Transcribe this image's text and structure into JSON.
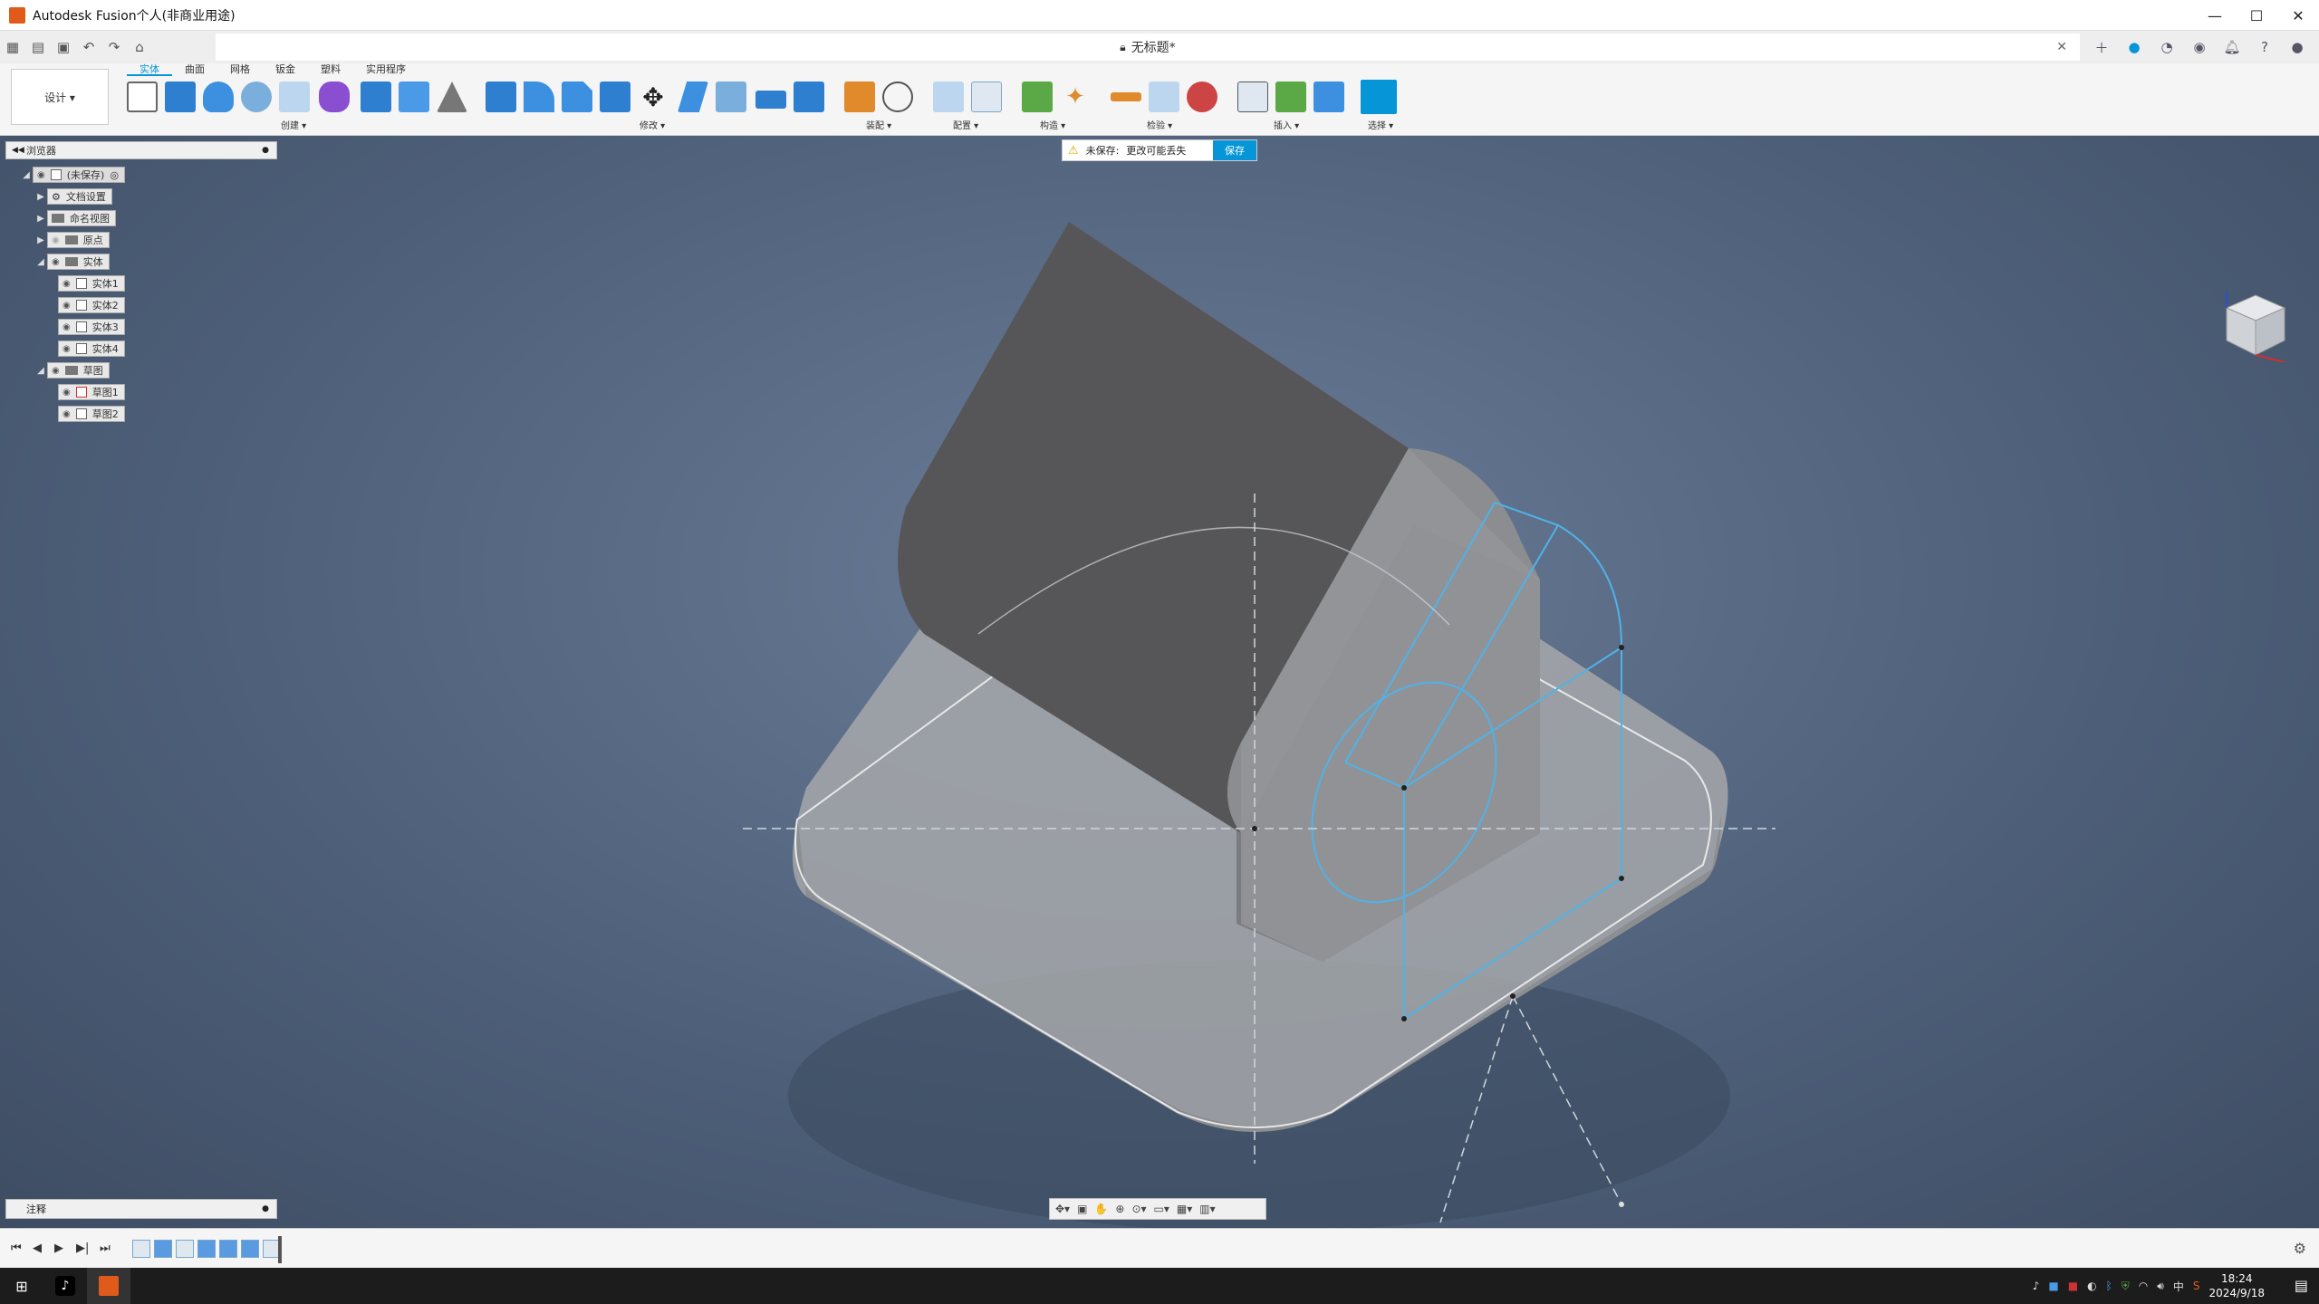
{
  "app": {
    "title": "Autodesk Fusion个人(非商业用途)",
    "document_title": "无标题*"
  },
  "ribbon": {
    "workspace": "设计 ▾",
    "tabs": [
      "实体",
      "曲面",
      "网格",
      "钣金",
      "塑料",
      "实用程序"
    ],
    "groups": [
      "创建 ▾",
      "修改 ▾",
      "装配 ▾",
      "配置 ▾",
      "构造 ▾",
      "检验 ▾",
      "插入 ▾",
      "选择 ▾"
    ]
  },
  "browser": {
    "title": "浏览器",
    "root": "(未保存)",
    "items": [
      "文档设置",
      "命名视图",
      "原点",
      "实体",
      "实体1",
      "实体2",
      "实体3",
      "实体4",
      "草图",
      "草图1",
      "草图2"
    ]
  },
  "banner": {
    "label": "未保存:",
    "message": "更改可能丢失",
    "save": "保存"
  },
  "comments": {
    "title": "注释"
  },
  "taskbar": {
    "time": "18:24",
    "date": "2024/9/18",
    "ime": "中"
  },
  "colors": {
    "accent": "#0696d7",
    "sketch": "#4fb3e8",
    "viewport_bg": "#4d5e78"
  }
}
